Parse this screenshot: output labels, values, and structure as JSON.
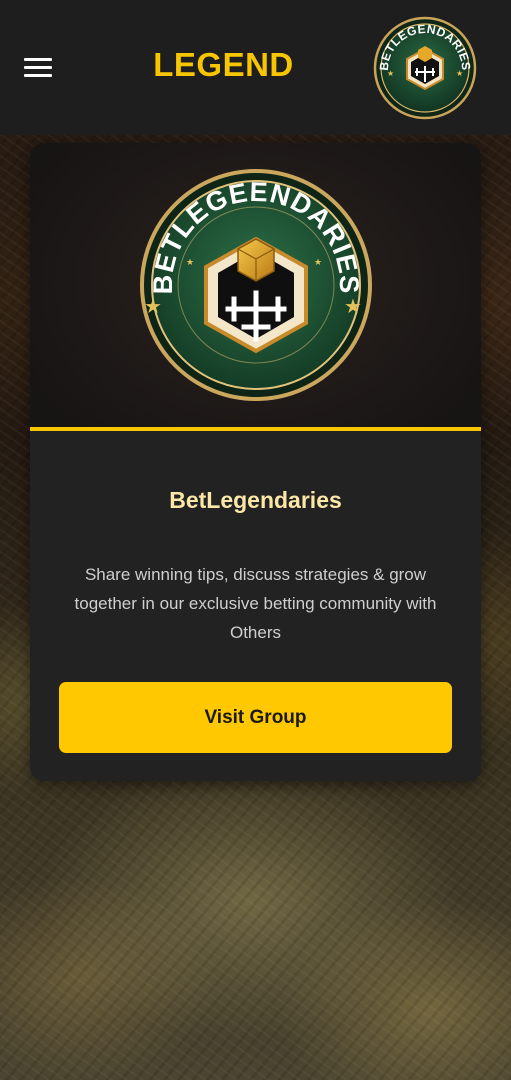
{
  "header": {
    "menu_icon": "hamburger-menu-icon",
    "brand_title": "LEGEND",
    "avatar_logo_text": "BETLEGENDARIES"
  },
  "card": {
    "logo_text": "BETLEGEENDARIES",
    "title": "BetLegendaries",
    "description": "Share winning tips, discuss strategies & grow together in our exclusive betting community with Others",
    "button_label": "Visit Group"
  },
  "colors": {
    "accent": "#f7c600",
    "button": "#ffc800",
    "topbar": "#1e1e1e",
    "card": "#222222",
    "title_text": "#fbe7a8",
    "logo_green": "#1f4d32"
  }
}
